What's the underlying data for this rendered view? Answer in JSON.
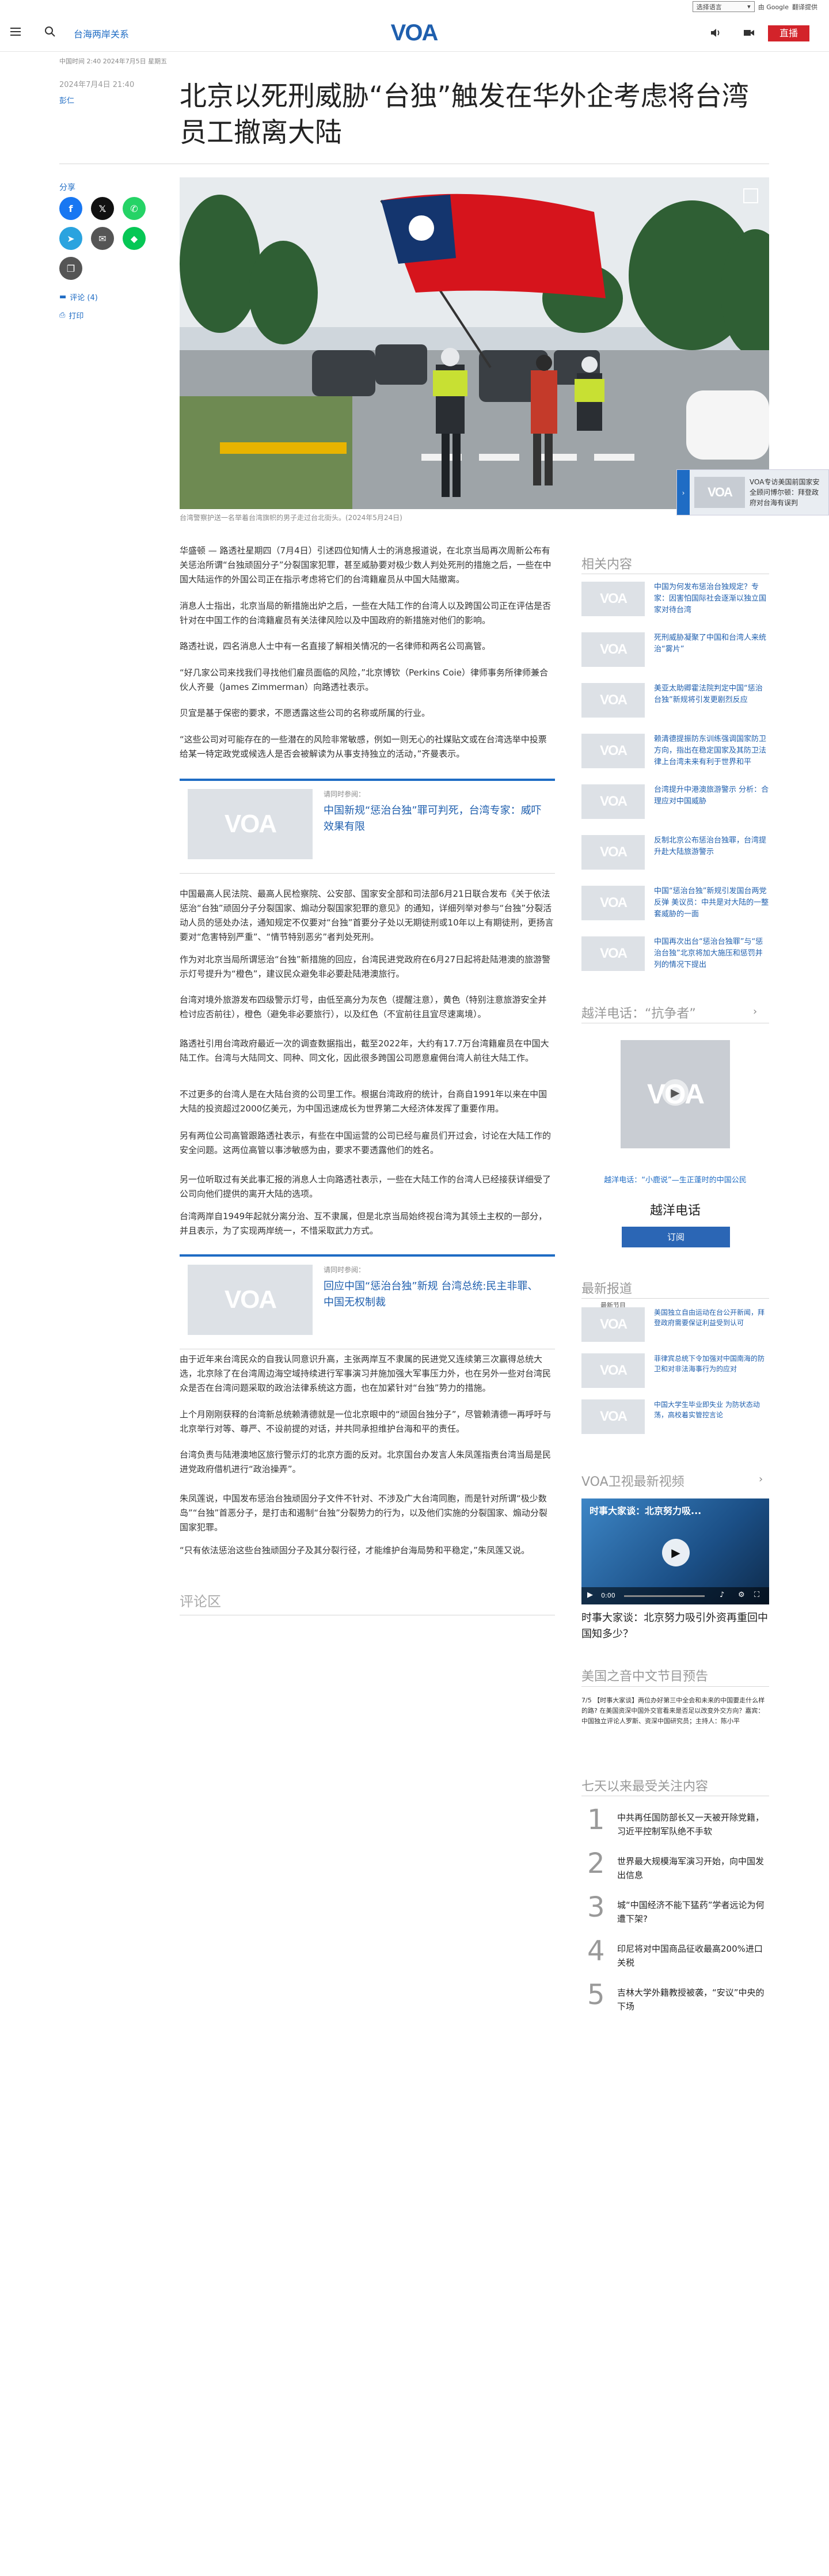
{
  "google_translate": {
    "select_label": "选择语言",
    "powered": "由 Google",
    "translate": "翻译提供"
  },
  "header": {
    "section": "台海两岸关系",
    "logo": "VOA",
    "live_label": "直播"
  },
  "article": {
    "meta_line": "中国时间 2:40 2024年7月5日 星期五",
    "date": "2024年7月4日 21:40",
    "author": "彭仁",
    "title": "北京以死刑威胁“台独”触发在华外企考虑将台湾员工撤离大陆",
    "caption": "台湾警察护送一名举着台湾旗帜的男子走过台北街头。(2024年5月24日)",
    "share_label": "分享",
    "comments_link": "评论 (4)",
    "print_link": "打印",
    "paragraphs": [
      "华盛顿 — 路透社星期四（7月4日）引述四位知情人士的消息报道说，在北京当局再次周新公布有关惩治所谓“台独顽固分子”分裂国家犯罪，甚至威胁要对极少数人判处死刑的措施之后，一些在中国大陆运作的外国公司正在指示考虑将它们的台湾籍雇员从中国大陆撤离。",
      "消息人士指出，北京当局的新措施出炉之后，一些在大陆工作的台湾人以及跨国公司正在评估是否针对在中国工作的台湾籍雇员有关法律风险以及中国政府的新措施对他们的影响。",
      "路透社说，四名消息人士中有一名直接了解相关情况的一名律师和两名公司高管。",
      "“好几家公司来找我们寻找他们雇员面临的风险，”北京博钦（Perkins Coie）律师事务所律师兼合伙人齐曼（James Zimmerman）向路透社表示。",
      "贝宜是基于保密的要求，不愿透露这些公司的名称或所属的行业。",
      "“这些公司对可能存在的一些潜在的风险非常敏感，例如一则无心的社媒贴文或在台湾选举中投票给某一特定政党或候选人是否会被解读为从事支持独立的活动，”齐曼表示。",
      "中国最高人民法院、最高人民检察院、公安部、国家安全部和司法部6月21日联合发布《关于依法惩治“台独”顽固分子分裂国家、煽动分裂国家犯罪的意见》的通知，详细列举对参与“台独”分裂活动人员的惩处办法，通知规定不仅要对“台独”首要分子处以无期徒刑或10年以上有期徒刑，更扬言要对“危害特别严重”、“情节特别恶劣”者判处死刑。",
      "作为对北京当局所谓惩治“台独”新措施的回应，台湾民进党政府在6月27日起将赴陆港澳的旅游警示灯号提升为“橙色”，建议民众避免非必要赴陆港澳旅行。",
      "台湾对境外旅游发布四级警示灯号，由低至高分为灰色（提醒注意），黄色（特别注意旅游安全并检讨应否前往），橙色（避免非必要旅行），以及红色（不宜前往且宜尽速离境）。",
      "路透社引用台湾政府最近一次的调查数据指出，截至2022年，大约有17.7万台湾籍雇员在中国大陆工作。台湾与大陆同文、同种、同文化，因此很多跨国公司愿意雇佣台湾人前往大陆工作。",
      "不过更多的台湾人是在大陆台资的公司里工作。根据台湾政府的统计，台商自1991年以来在中国大陆的投资超过2000亿美元，为中国迅速成长为世界第二大经济体发挥了重要作用。",
      "另有两位公司高管跟路透社表示，有些在中国运营的公司已经与雇员们开过会，讨论在大陆工作的安全问题。这两位高管以事涉敏感为由，要求不要透露他们的姓名。",
      "另一位听取过有关此事汇报的消息人士向路透社表示，一些在大陆工作的台湾人已经接获详细受了公司向他们提供的离开大陆的选项。",
      "台湾两岸自1949年起就分离分治、互不隶属，但是北京当局始终视台湾为其领土主权的一部分，并且表示，为了实现两岸统一，不惜采取武力方式。",
      "由于近年来台湾民众的自我认同意识升高，主张两岸互不隶属的民进党又连续第三次赢得总统大选，北京除了在台湾周边海空域持续进行军事演习并施加强大军事压力外，也在另外一些对台湾民众是否在台湾问题采取的政治法律系统这方面，也在加紧针对“台独”势力的措施。",
      "上个月刚刚获释的台湾新总统赖清德就是一位北京眼中的“顽固台独分子”，尽管赖清德一再呼吁与北京举行对等、尊严、不设前提的对话，并共同承担维护台海和平的责任。",
      "台湾负责与陆港澳地区旅行警示灯的北京方面的反对。北京国台办发言人朱凤莲指责台湾当局是民进党政府借机进行“政治操弄”。",
      "朱凤莲说，中国发布惩治台独顽固分子文件不针对、不涉及广大台湾同胞，而是针对所谓“极少数岛”“台独”首恶分子，是打击和遏制“台独”分裂势力的行为，以及他们实施的分裂国家、煽动分裂国家犯罪。",
      "“只有依法惩治这些台独顽固分子及其分裂行径，才能维护台海局势和平稳定，”朱凤莲又说。"
    ],
    "related_boxes": [
      {
        "label": "请同时参阅：",
        "headline": "中国新规“惩治台独”罪可判死，台湾专家：威吓效果有限"
      },
      {
        "label": "请同时参阅：",
        "headline": "回应中国“惩治台独”新规 台湾总统:民主非罪、中国无权制裁"
      }
    ],
    "comments_heading": "评论区"
  },
  "floater": {
    "text": "VOA专访美国前国家安全顾问博尔顿：拜登政府对台海有误判"
  },
  "sidebar": {
    "related_title": "相关内容",
    "related": [
      "中国为何发布惩治台独规定？专家：因害怕国际社会逐渐以独立国家对待台湾",
      "死刑威胁凝聚了中国和台湾人来统治“雾片”",
      "美亚太助卿霍法院判定中国“惩治台独”新规将引发更剧烈反应",
      "赖清德提振防东训练强调国家防卫方向，指出在稳定国家及其防卫法律上台湾未来有利于世界和平",
      "台湾提升中港澳旅游警示 分析：合理应对中国威胁",
      "反制北京公布惩治台独罪，台湾提升赴大陆旅游警示",
      "中国“惩治台独”新规引发国台两党反弹 美议员：中共是对大陆的一整套威胁的一面",
      "中国再次出台“惩治台独罪”与“惩治台独”北京将加大施压和惩罚并列的情况下提出"
    ],
    "hotline_title": "越洋电话：“抗争者”",
    "hotline_subtitle": "越洋电话：“小鹿说”—生正蓬时的中国公民",
    "hotline_name": "越洋电话",
    "subscribe": "订阅",
    "latest_title": "最新报道",
    "latest_label": "最新节目",
    "latest": [
      "美国独立自由运动在台公开新闻，拜登政府需要保证利益受到认可",
      "菲律宾总统下令加强对中国南海的防卫和对非法海事行为的应对",
      "中国大学生毕业即失业 为防状态动荡，高校着实管控言论"
    ],
    "video_title": "VOA卫视最新视频",
    "video_caption": "时事大家谈：北京努力吸引外资再重回中国知多少？",
    "video_overlay": "时事大家谈：北京努力吸...",
    "video_time": "0:00",
    "preview_title": "美国之音中文节目预告",
    "preview_text": "7/5 【时事大家谈】两位办好第三中全会和未来的中国要走什么样的路? 在美国资深中国外交官看来是否足以改变外交方向？嘉宾：中国独立评论人罗斯、资深中国研究员；主持人：陈小平",
    "top_title": "七天以来最受关注内容",
    "top": [
      "中共再任国防部长又一天被开除党籍，习近平控制军队绝不手软",
      "世界最大规模海军演习开始，向中国发出信息",
      "城“中国经济不能下猛药”学者远论为何遭下架?",
      "印尼将对中国商品征收最高200%进口关税",
      "吉林大学外籍教授被袭，“安议”中央的下场"
    ]
  }
}
